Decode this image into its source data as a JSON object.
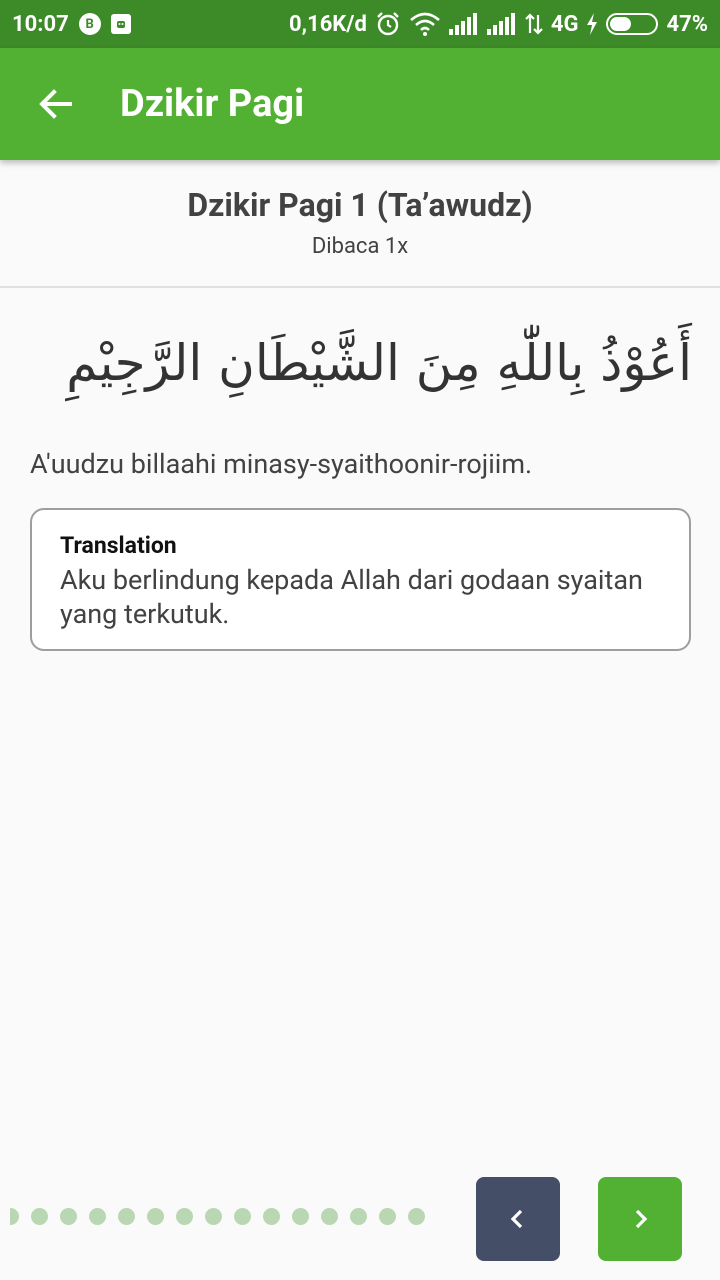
{
  "status_bar": {
    "time": "10:07",
    "bubble_letter": "B",
    "network_speed": "0,16K/d",
    "network_type": "4G",
    "battery": "47%",
    "icons": [
      "whatsapp-business-icon",
      "notification-icon",
      "alarm-icon",
      "wifi-icon",
      "signal-icon",
      "signal-icon",
      "data-arrows-icon",
      "charging-icon",
      "battery-icon"
    ]
  },
  "app_bar": {
    "title": "Dzikir Pagi",
    "back_icon": "arrow-left-icon"
  },
  "dzikir": {
    "title": "Dzikir Pagi 1 (Ta’awudz)",
    "subtitle": "Dibaca 1x",
    "arabic": "أَعُوْذُ بِاللّٰهِ مِنَ الشَّيْطَانِ الرَّجِيْمِ",
    "latin": "A'uudzu billaahi minasy-syaithoonir-rojiim."
  },
  "translation": {
    "label": "Translation",
    "text": "Aku berlindung kepada Allah dari godaan syaitan yang terkutuk."
  },
  "pager": {
    "dot_count": 15
  },
  "colors": {
    "status_bar": "#3d8b28",
    "app_bar": "#52b032",
    "prev_button": "#444e66",
    "next_button": "#52b032",
    "dot": "#b9d7b2"
  }
}
